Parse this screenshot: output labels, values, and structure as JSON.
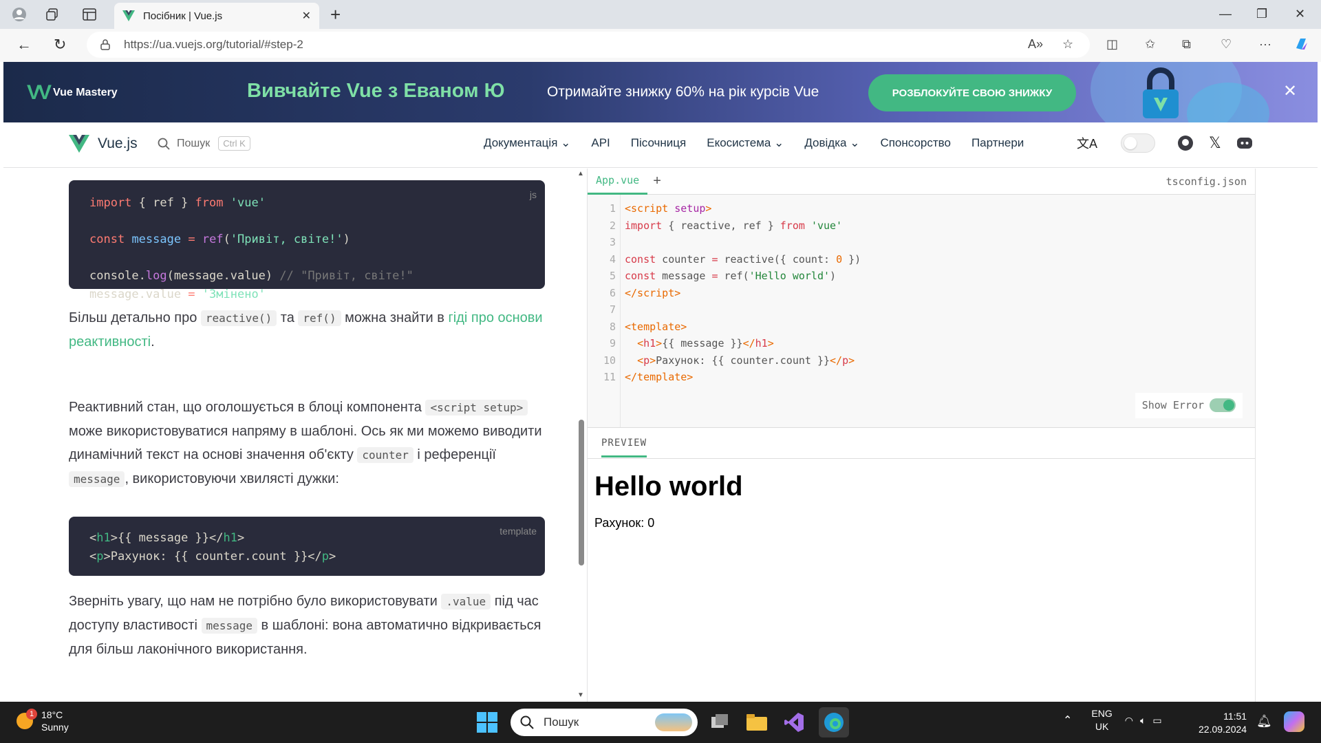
{
  "browser": {
    "tab_title": "Посібник | Vue.js",
    "url": "https://ua.vuejs.org/tutorial/#step-2"
  },
  "banner": {
    "brand": "Vue Mastery",
    "headline": "Вивчайте Vue з Еваном Ю",
    "subtext": "Отримайте знижку 60% на рік курсів Vue",
    "cta": "РОЗБЛОКУЙТЕ СВОЮ ЗНИЖКУ"
  },
  "nav": {
    "brand": "Vue.js",
    "search_label": "Пошук",
    "search_kbd": "Ctrl K",
    "links": [
      "Документація ⌄",
      "API",
      "Пісочниця",
      "Екосистема ⌄",
      "Довідка ⌄",
      "Спонсорство",
      "Партнери"
    ]
  },
  "article": {
    "code1_lang": "js",
    "para1": {
      "a": "Більш детально про ",
      "c1": "reactive()",
      "b": " та ",
      "c2": "ref()",
      "c": " можна знайти в ",
      "link": "гіді про основи реактивності",
      "d": "."
    },
    "para2": {
      "a": "Реактивний стан, що оголошується в блоці компонента ",
      "c1": "<script setup>",
      "b": " може використовуватися напряму в шаблоні. Ось як ми можемо виводити динамічний текст на основі значення об'єкту ",
      "c2": "counter",
      "c": " і референції ",
      "c3": "message",
      "d": ", використовуючи хвилясті дужки:"
    },
    "code2_lang": "template",
    "para3": {
      "a": "Зверніть увагу, що нам не потрібно було використовувати ",
      "c1": ".value",
      "b": " під час доступу властивості ",
      "c2": "message",
      "c": " в шаблоні: вона автоматично відкривається для більш лаконічного використання."
    }
  },
  "editor": {
    "tab_active": "App.vue",
    "tab_add": "+",
    "tab_right": "tsconfig.json",
    "show_error": "Show Error",
    "preview_tab": "PREVIEW",
    "line_numbers": [
      "1",
      "2",
      "3",
      "4",
      "5",
      "6",
      "7",
      "8",
      "9",
      "10",
      "11"
    ]
  },
  "preview": {
    "h1": "Hello world",
    "p": "Рахунок: 0"
  },
  "taskbar": {
    "temp": "18°C",
    "weather": "Sunny",
    "weather_badge": "1",
    "search": "Пошук",
    "lang1": "ENG",
    "lang2": "UK",
    "time": "11:51",
    "date": "22.09.2024"
  }
}
